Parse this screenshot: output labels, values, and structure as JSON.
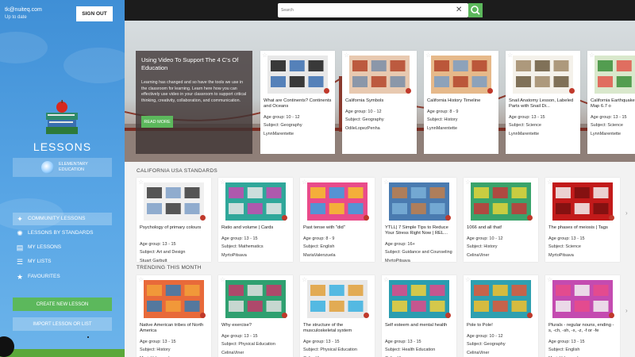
{
  "user": {
    "email": "tk@nuiteq.com",
    "status": "Up to date",
    "signout_label": "SIGN OUT"
  },
  "sidebar": {
    "title": "LESSONS",
    "level": {
      "line1": "ELEMENTARY",
      "line2": "EDUCATION"
    },
    "nav": [
      {
        "label": "COMMUNITY LESSONS",
        "icon": "bird-icon",
        "glyph": "✦",
        "active": true
      },
      {
        "label": "LESSONS BY STANDARDS",
        "icon": "lightbulb-icon",
        "glyph": "✺",
        "active": false
      },
      {
        "label": "MY LESSONS",
        "icon": "my-lessons-icon",
        "glyph": "▤",
        "active": false
      },
      {
        "label": "MY LISTS",
        "icon": "list-icon",
        "glyph": "☰",
        "active": false
      },
      {
        "label": "FAVOURITES",
        "icon": "star-icon",
        "glyph": "★",
        "active": false
      }
    ],
    "create_label": "CREATE NEW LESSON",
    "import_label": "IMPORT LESSON OR LIST"
  },
  "search": {
    "placeholder": "Search"
  },
  "hero": {
    "title": "Using Video To Support The 4 C's Of Education",
    "body": "Learning has changed and so have the tools we use in the classroom for learning. Learn here how you can effectively use video in your classroom to support critical thinking, creativity, collaboration, and communication.",
    "button_label": "READ MORE",
    "cards": [
      {
        "title": "What are Continents? Continents  and Oceans",
        "age": "Age group: 10 - 12",
        "subject": "Subject: Geography",
        "author": "LynnMarentette",
        "thumb": [
          "#e8e8e8",
          "#1a1a1a",
          "#3b6fb0"
        ]
      },
      {
        "title": "California Symbols",
        "age": "Age group: 10 - 12",
        "subject": "Subject: Geography",
        "author": "OdileLopezPenha",
        "thumb": [
          "#e8c9b0",
          "#b4462c",
          "#7a8ea8"
        ]
      },
      {
        "title": "California History Timeline",
        "age": "Age group: 8 - 9",
        "subject": "Subject: History",
        "author": "LynnMarentette",
        "thumb": [
          "#e6b98a",
          "#b3452c",
          "#7c9ec2"
        ]
      },
      {
        "title": "Snail Anatomy Lesson, Labeled Parts with Snail Di...",
        "age": "Age group: 13 - 15",
        "subject": "Subject: Science",
        "author": "LynnMarentette",
        "thumb": [
          "#f4f1ea",
          "#a08968",
          "#6b5b3e"
        ]
      },
      {
        "title": "California Earthquake Forecast Map 6.7 o",
        "age": "Age group: 13 - 15",
        "subject": "Subject: Science",
        "author": "LynnMarentette",
        "thumb": [
          "#d9e8cc",
          "#3b8f3a",
          "#e0584c"
        ]
      }
    ]
  },
  "sections": [
    {
      "title": "CALIFORNIA USA STANDARDS",
      "cards": [
        {
          "title": "Psychology of primary colours",
          "age": "Age group: 13 - 15",
          "subject": "Subject: Art and Design",
          "author": "Stuart Garbutt",
          "thumb": [
            "#f0f0f0",
            "#3a3a3a",
            "#7fa0c8"
          ]
        },
        {
          "title": "Ratio and volume | Cards",
          "age": "Age group: 13 - 15",
          "subject": "Subject: Mathematics",
          "author": "MyrtoPitsava",
          "thumb": [
            "#2fa79a",
            "#c44bb0",
            "#e7e7e7"
          ]
        },
        {
          "title": "Past tense with \"did\"",
          "age": "Age group: 8 - 9",
          "subject": "Subject: English",
          "author": "MariaValenzuela",
          "thumb": [
            "#e94b8a",
            "#f6c02c",
            "#3aa0e0"
          ]
        },
        {
          "title": "YTLL| 7 Simple Tips to Reduce Your Stress Right Now | REL...",
          "age": "Age group: 16+",
          "subject": "Subject: Guidance and Counseling",
          "author": "MyrtoPitsava",
          "thumb": [
            "#4a7bb0",
            "#c07f4c",
            "#7ab0d8"
          ]
        },
        {
          "title": "1066 and all that!",
          "age": "Age group: 10 - 12",
          "subject": "Subject: History",
          "author": "CelinaViner",
          "thumb": [
            "#3aa36b",
            "#e3d53a",
            "#c43a3a"
          ]
        },
        {
          "title": "The phases of meiosis | Tags",
          "age": "Age group: 13 - 15",
          "subject": "Subject: Science",
          "author": "MyrtoPitsava",
          "thumb": [
            "#c21a1a",
            "#f2f2f2",
            "#7a1010"
          ]
        }
      ]
    },
    {
      "title": "TRENDING THIS MONTH",
      "cards": [
        {
          "title": "Native American tribes of North America",
          "age": "Age group: 13 - 15",
          "subject": "Subject: History",
          "author": "MariaValenzuela",
          "thumb": [
            "#e86a3a",
            "#f2a03a",
            "#3a7ab0"
          ]
        },
        {
          "title": "Why exercise?",
          "age": "Age group: 13 - 15",
          "subject": "Subject: Physical Education",
          "author": "CelinaViner",
          "thumb": [
            "#2fa070",
            "#c43a6a",
            "#e0e0e0"
          ]
        },
        {
          "title": "The structure of the musculoskeletal system",
          "age": "Age group: 13 - 15",
          "subject": "Subject: Physical Education",
          "author": "CelinaViner",
          "thumb": [
            "#e8e8e8",
            "#e0a03a",
            "#3ab0e0"
          ]
        },
        {
          "title": "Self esteem and mental health",
          "age": "Age group: 13 - 15",
          "subject": "Subject: Health Education",
          "author": "CelinaViner",
          "thumb": [
            "#2a9db0",
            "#e04a8a",
            "#f2d03a"
          ]
        },
        {
          "title": "Pole to Pole!",
          "age": "Age group: 10 - 12",
          "subject": "Subject: Geography",
          "author": "CelinaViner",
          "thumb": [
            "#2fa0b0",
            "#e0583a",
            "#f2c02c"
          ]
        },
        {
          "title": "Plurals - regular nouns, ending -s, -ch, -sh, -x, -z, -f or -fe",
          "age": "Age group: 13 - 15",
          "subject": "Subject: English",
          "author": "MariaValenzuela",
          "thumb": [
            "#c44bb0",
            "#e94b8a",
            "#f2f2f2"
          ]
        }
      ]
    }
  ],
  "colors": {
    "sidebar": "#4a9de0",
    "accent": "#5cb85c",
    "topbar": "#1c1c1c"
  }
}
